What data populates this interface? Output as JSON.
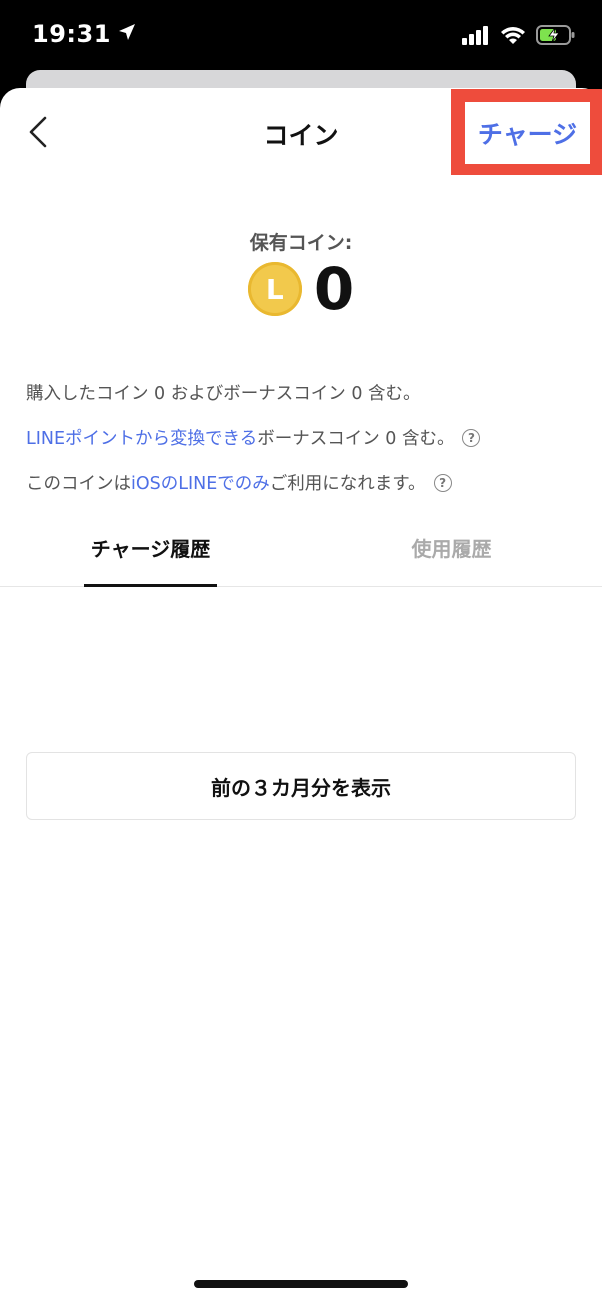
{
  "status_bar": {
    "time": "19:31",
    "icons": [
      "location-arrow-icon",
      "signal-icon",
      "wifi-icon",
      "battery-charging-icon"
    ]
  },
  "nav": {
    "title": "コイン",
    "charge_label": "チャージ"
  },
  "balance": {
    "label": "保有コイン:",
    "coin_letter": "L",
    "value": "0"
  },
  "info": {
    "line1": "購入したコイン 0 およびボーナスコイン 0 含む。",
    "line2_link": "LINEポイントから変換できる",
    "line2_rest": "ボーナスコイン 0 含む。",
    "line3_pre": "このコインは",
    "line3_link": "iOSのLINEでのみ",
    "line3_post": "ご利用になれます。",
    "help_symbol": "?"
  },
  "tabs": [
    {
      "label": "チャージ履歴",
      "active": true
    },
    {
      "label": "使用履歴",
      "active": false
    }
  ],
  "show_prev_label": "前の３カ月分を表示",
  "colors": {
    "accent": "#4e6fe6",
    "highlight": "#ee4c3c",
    "coin": "#f2c94c",
    "battery": "#7ee24e"
  }
}
